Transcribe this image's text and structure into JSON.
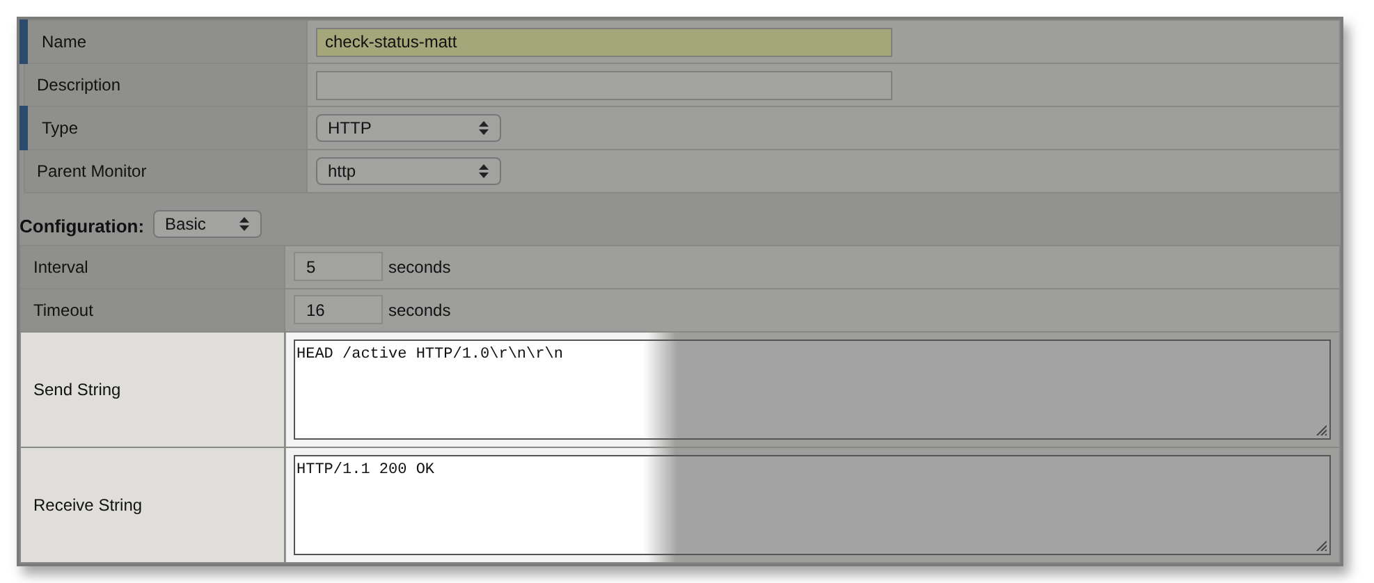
{
  "general": [
    {
      "label": "Name",
      "required": true,
      "kind": "text",
      "value": "check-status-matt",
      "tinted": true
    },
    {
      "label": "Description",
      "required": false,
      "kind": "text",
      "tinted": false
    },
    {
      "label": "Type",
      "required": true,
      "kind": "select",
      "value": "HTTP"
    },
    {
      "label": "Parent Monitor",
      "required": false,
      "kind": "select",
      "value": "http"
    }
  ],
  "configuration": {
    "label": "Configuration:",
    "value": "Basic"
  },
  "settings": [
    {
      "label": "Interval",
      "kind": "number",
      "value": "5",
      "unit": "seconds",
      "spotlit": false
    },
    {
      "label": "Timeout",
      "kind": "number",
      "value": "16",
      "unit": "seconds",
      "spotlit": false
    },
    {
      "label": "Send String",
      "kind": "textarea",
      "value": "HEAD /active HTTP/1.0\\r\\n\\r\\n",
      "spotlit": true
    },
    {
      "label": "Receive String",
      "kind": "textarea",
      "value": "HTTP/1.1 200 OK",
      "spotlit": true
    }
  ]
}
